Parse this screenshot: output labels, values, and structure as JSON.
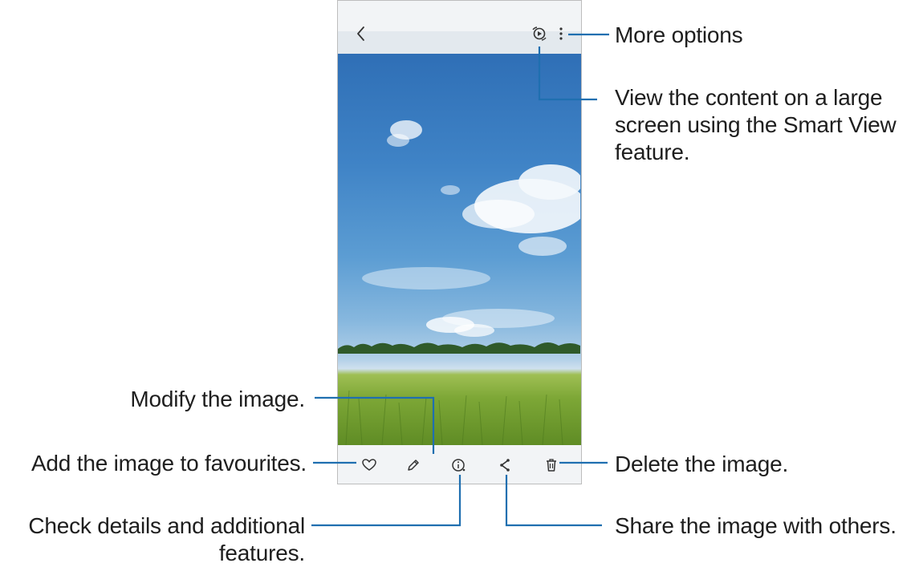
{
  "callouts": {
    "more_options": "More options",
    "smart_view_line1": "View the content on a large",
    "smart_view_line2": "screen using the Smart View",
    "smart_view_line3": "feature.",
    "modify": "Modify the image.",
    "favourites": "Add the image to favourites.",
    "delete": "Delete the image.",
    "details_line1": "Check details and additional",
    "details_line2": "features.",
    "share": "Share the image with others."
  },
  "icons": {
    "top": [
      "back-icon",
      "smart-view-icon",
      "more-options-icon"
    ],
    "bottom": [
      "favourite-icon",
      "edit-icon",
      "details-icon",
      "share-icon",
      "delete-icon"
    ]
  },
  "colors": {
    "leader_line": "#1f6fb0",
    "phone_border": "#bdbdbd",
    "bar_background": "#f2f4f6"
  }
}
